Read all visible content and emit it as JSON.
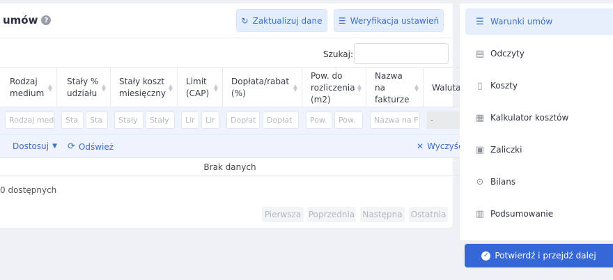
{
  "header": {
    "title": "umów",
    "refresh_label": "Zaktualizuj dane",
    "verify_label": "Weryfikacja ustawień"
  },
  "search": {
    "label": "Szukaj:",
    "value": ""
  },
  "columns": [
    "Rodzaj medium",
    "Stały % udziału",
    "Stały koszt miesięczny",
    "Limit (CAP)",
    "Dopłata/rabat (%)",
    "Pow. do rozliczenia (m2)",
    "Nazwa na fakturze",
    "Waluta"
  ],
  "filters": {
    "rodzaj": "Rodzaj med",
    "staly1a": "Sta",
    "staly1b": "Sta",
    "koszt_a": "Stały",
    "koszt_b": "Stały",
    "limit_a": "Lir",
    "limit_b": "Lir",
    "doplata_a": "Dopłat",
    "doplata_b": "Dopłat",
    "pow_a": "Pow.",
    "pow_b": "Pow.",
    "nazwa": "Nazwa na F",
    "waluta": "-"
  },
  "toolbar": {
    "customize_label": "Dostosuj",
    "refresh_label": "Odśwież",
    "clear_label": "Wyczyść f"
  },
  "table": {
    "empty_message": "Brak danych"
  },
  "footer": {
    "count_text": "0 dostępnych",
    "pagination": [
      "Pierwsza",
      "Poprzednia",
      "Następna",
      "Ostatnia"
    ]
  },
  "sidebar": {
    "items": [
      {
        "label": "Warunki umów",
        "icon": "sliders-icon",
        "active": true
      },
      {
        "label": "Odczyty",
        "icon": "meter-icon"
      },
      {
        "label": "Koszty",
        "icon": "document-icon"
      },
      {
        "label": "Kalkulator kosztów",
        "icon": "calculator-icon"
      },
      {
        "label": "Zaliczki",
        "icon": "money-icon"
      },
      {
        "label": "Bilans",
        "icon": "magnifier-icon"
      },
      {
        "label": "Podsumowanie",
        "icon": "clipboard-icon"
      }
    ],
    "confirm_label": "Potwierdź i przejdź dalej"
  },
  "colors": {
    "accent": "#3567d6",
    "accent_light": "#e4edfc",
    "background": "#eef0f4"
  }
}
